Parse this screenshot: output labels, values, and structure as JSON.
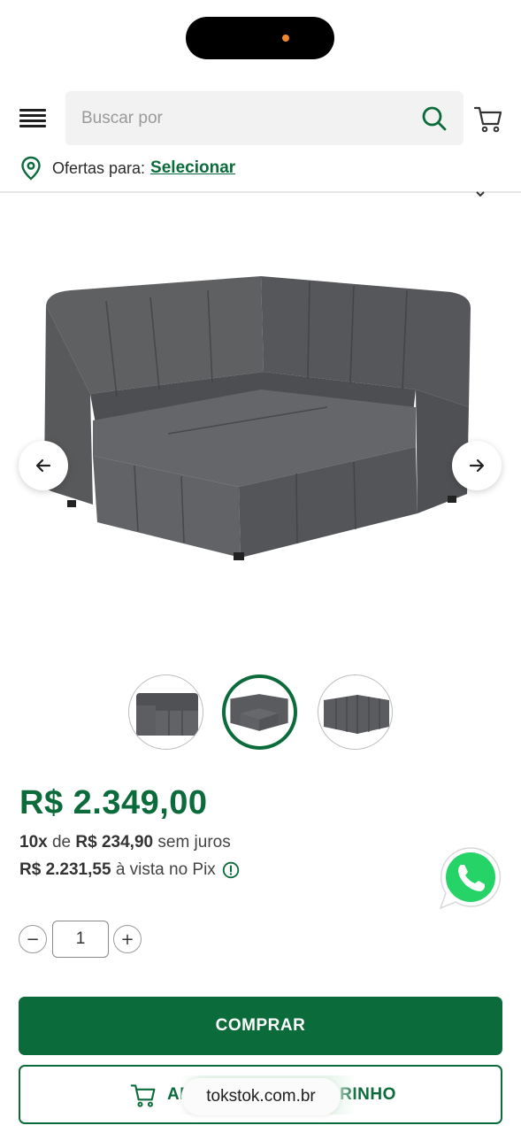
{
  "status_bar": {
    "notch_dot_color": "#f0862e"
  },
  "header": {
    "menu_icon": "hamburger-menu-icon",
    "search": {
      "placeholder": "Buscar por",
      "value": "",
      "icon": "search-icon"
    },
    "cart_icon": "shopping-cart-icon"
  },
  "location": {
    "icon": "map-pin-icon",
    "label": "Ofertas para:",
    "link": "Selecionar"
  },
  "gallery": {
    "prev_icon": "arrow-left-icon",
    "next_icon": "arrow-right-icon",
    "thumbnails": [
      {
        "name": "thumbnail-front",
        "active": false
      },
      {
        "name": "thumbnail-angled",
        "active": true
      },
      {
        "name": "thumbnail-back",
        "active": false
      }
    ]
  },
  "price": {
    "main": "R$ 2.349,00",
    "installments_count": "10x",
    "installments_word": "de",
    "installment_value": "R$ 234,90",
    "installments_suffix": "sem juros",
    "pix_value": "R$ 2.231,55",
    "pix_suffix": "à vista no Pix",
    "info_icon": "info-icon"
  },
  "quantity": {
    "minus": "−",
    "value": "1",
    "plus": "+"
  },
  "actions": {
    "buy_label": "COMPRAR",
    "cart_label": "ADICIONAR AO CARRINHO",
    "cart_icon": "cart-icon"
  },
  "whatsapp_icon": "whatsapp-icon",
  "browser": {
    "url": "tokstok.com.br"
  },
  "colors": {
    "brand_green": "#0b6b3a",
    "whatsapp_green": "#25d366",
    "sofa_gray": "#5b5c5e"
  }
}
